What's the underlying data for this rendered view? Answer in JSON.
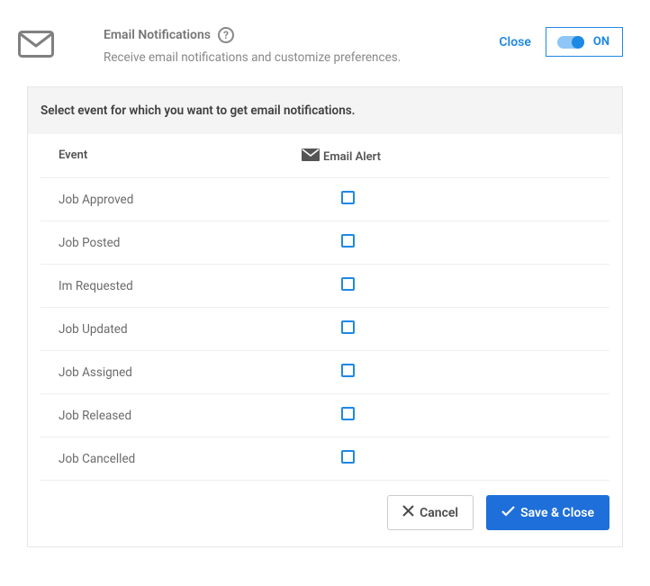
{
  "header": {
    "title": "Email Notifications",
    "subtitle": "Receive email notifications and customize preferences.",
    "close_label": "Close",
    "toggle_state": "ON"
  },
  "panel": {
    "heading": "Select event for which you want to get email notifications.",
    "columns": {
      "event": "Event",
      "email_alert": "Email Alert"
    },
    "events": [
      {
        "label": "Job Approved",
        "checked": false
      },
      {
        "label": "Job Posted",
        "checked": false
      },
      {
        "label": "Im Requested",
        "checked": false
      },
      {
        "label": "Job Updated",
        "checked": false
      },
      {
        "label": "Job Assigned",
        "checked": false
      },
      {
        "label": "Job Released",
        "checked": false
      },
      {
        "label": "Job Cancelled",
        "checked": false
      }
    ]
  },
  "actions": {
    "cancel": "Cancel",
    "save": "Save & Close"
  }
}
